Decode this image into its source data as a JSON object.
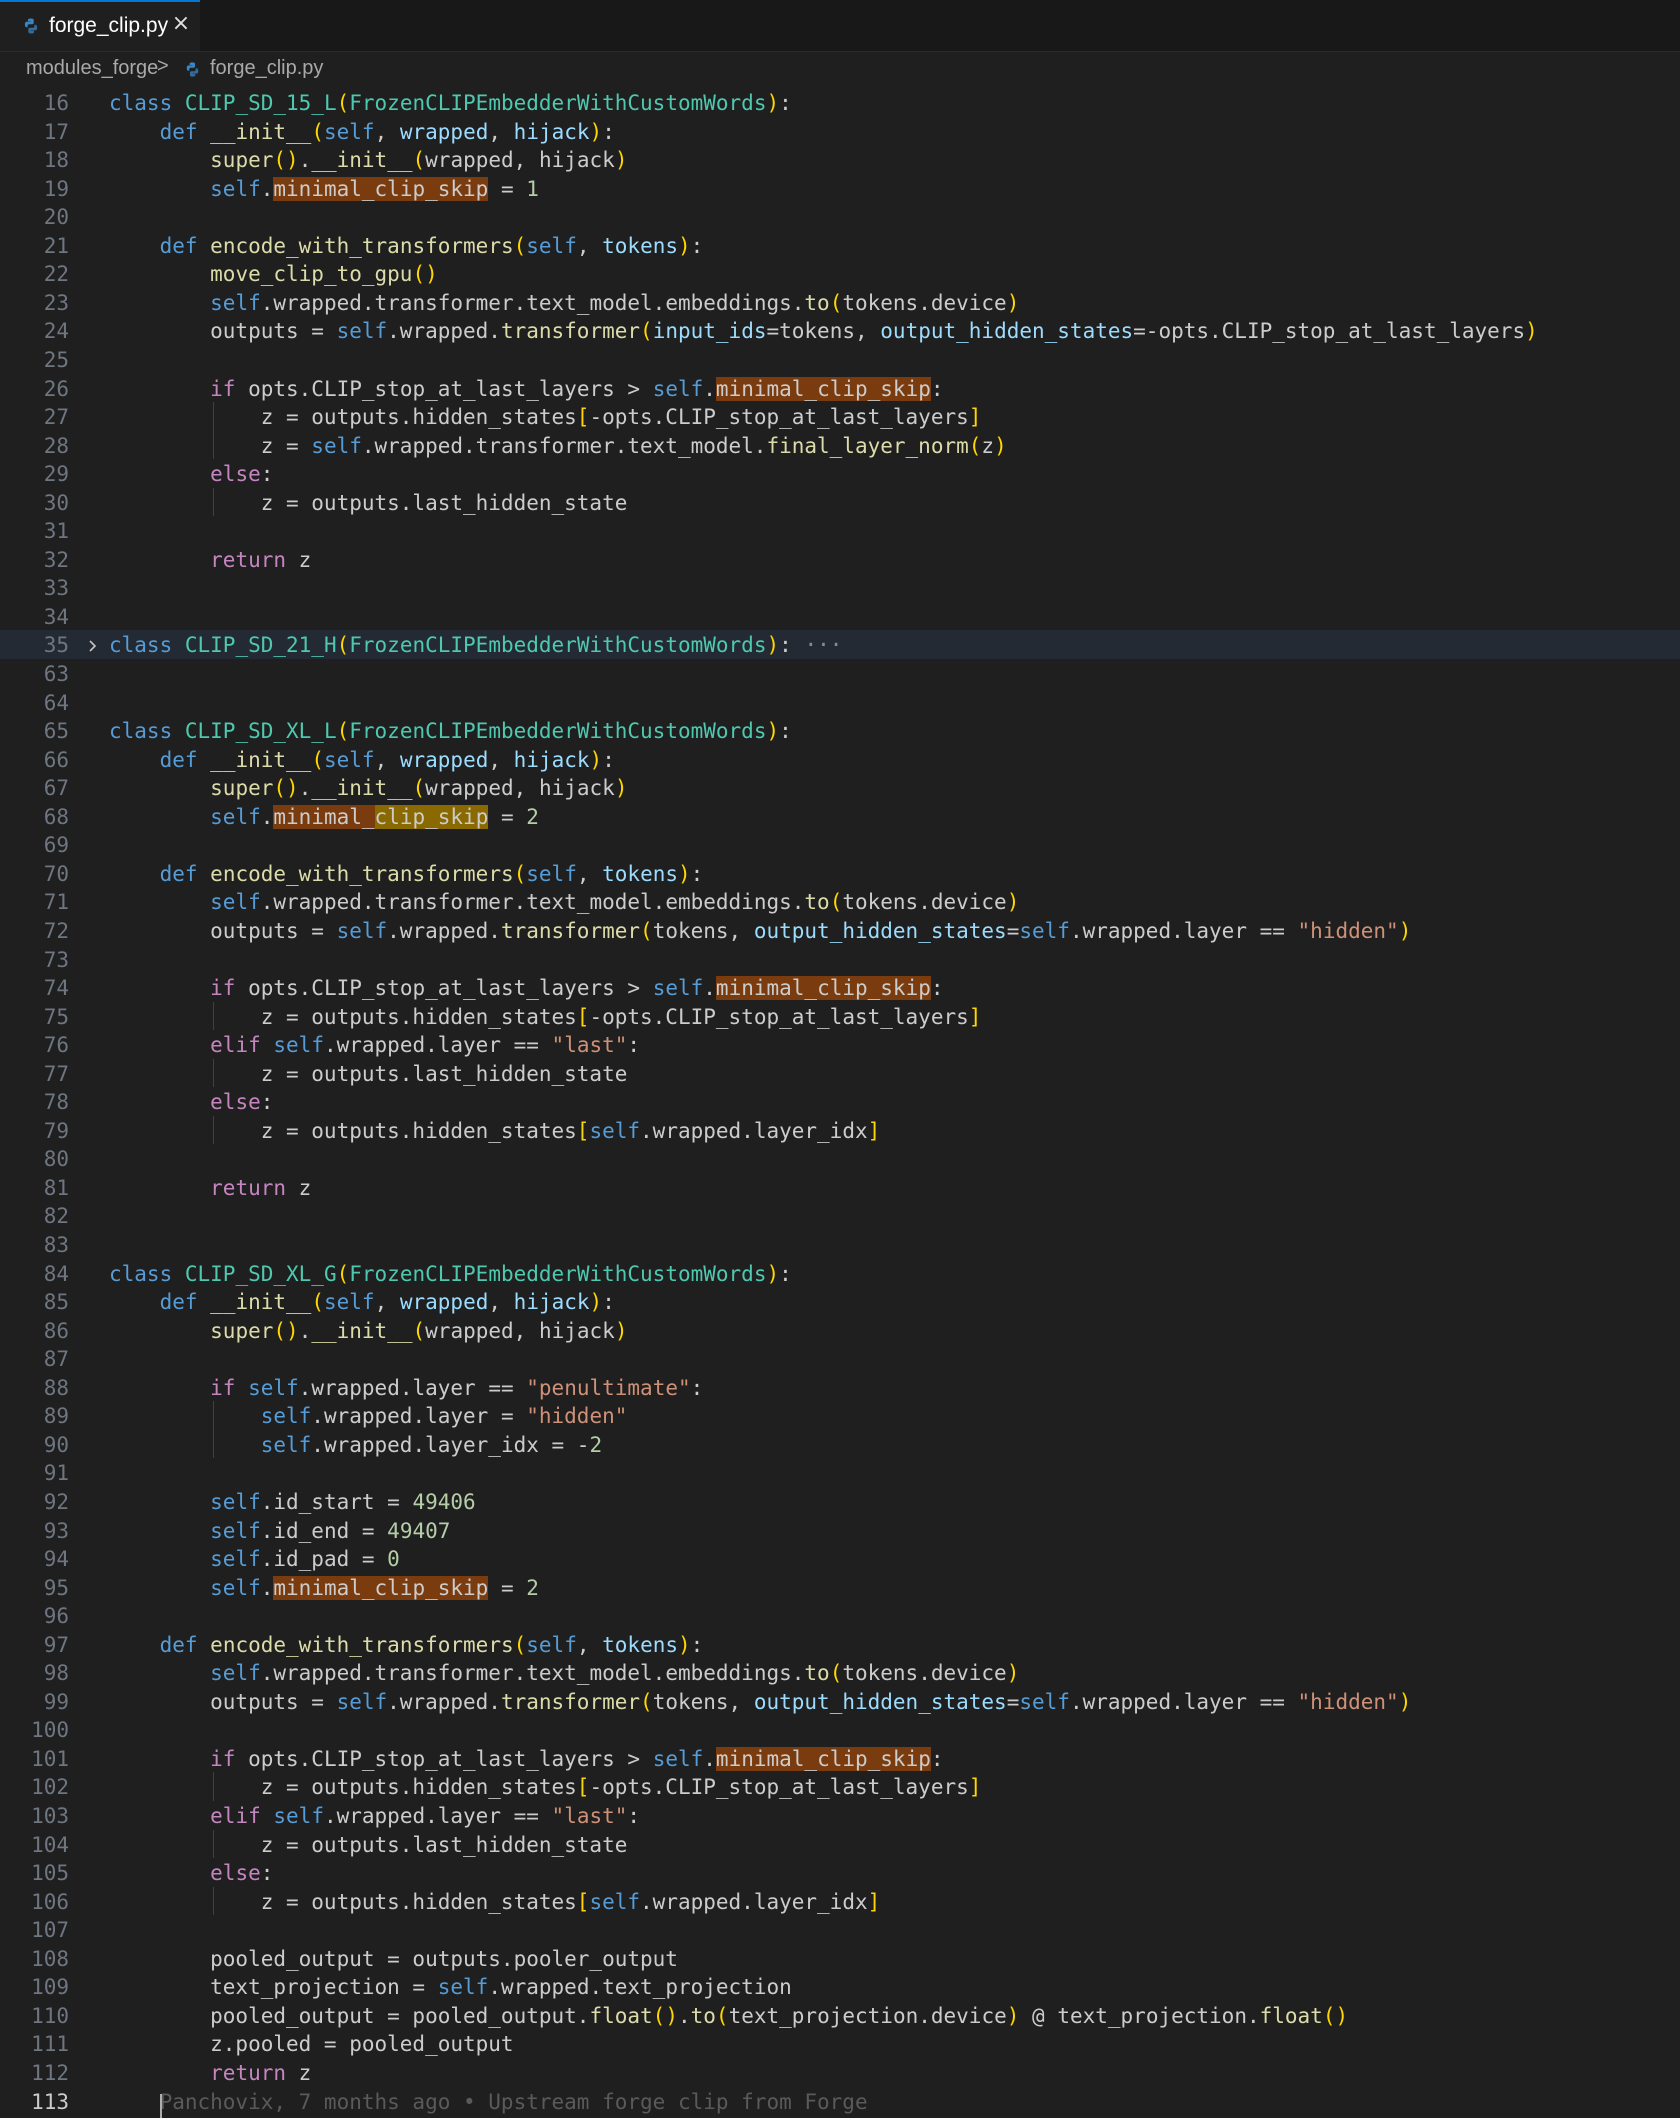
{
  "tab": {
    "label": "forge_clip.py",
    "icon": "python-file-icon",
    "close_icon": "close-icon",
    "close_glyph": "×"
  },
  "breadcrumb": {
    "folder": "modules_forge",
    "separator": ">",
    "file": "forge_clip.py"
  },
  "editor": {
    "accent": "#0078d4",
    "fold_line": "35",
    "blame": "Panchovix, 7 months ago • Upstream forge clip from Forge",
    "lines": [
      {
        "n": "16",
        "t": "class CLIP_SD_15_L(FrozenCLIPEmbedderWithCustomWords):"
      },
      {
        "n": "17",
        "t": "    def __init__(self, wrapped, hijack):"
      },
      {
        "n": "18",
        "t": "        super().__init__(wrapped, hijack)"
      },
      {
        "n": "19",
        "t": "        self.minimal_clip_skip = 1"
      },
      {
        "n": "20",
        "t": ""
      },
      {
        "n": "21",
        "t": "    def encode_with_transformers(self, tokens):"
      },
      {
        "n": "22",
        "t": "        move_clip_to_gpu()"
      },
      {
        "n": "23",
        "t": "        self.wrapped.transformer.text_model.embeddings.to(tokens.device)"
      },
      {
        "n": "24",
        "t": "        outputs = self.wrapped.transformer(input_ids=tokens, output_hidden_states=-opts.CLIP_stop_at_last_layers)"
      },
      {
        "n": "25",
        "t": ""
      },
      {
        "n": "26",
        "t": "        if opts.CLIP_stop_at_last_layers > self.minimal_clip_skip:"
      },
      {
        "n": "27",
        "t": "            z = outputs.hidden_states[-opts.CLIP_stop_at_last_layers]"
      },
      {
        "n": "28",
        "t": "            z = self.wrapped.transformer.text_model.final_layer_norm(z)"
      },
      {
        "n": "29",
        "t": "        else:"
      },
      {
        "n": "30",
        "t": "            z = outputs.last_hidden_state"
      },
      {
        "n": "31",
        "t": ""
      },
      {
        "n": "32",
        "t": "        return z"
      },
      {
        "n": "33",
        "t": ""
      },
      {
        "n": "34",
        "t": ""
      },
      {
        "n": "35",
        "t": "class CLIP_SD_21_H(FrozenCLIPEmbedderWithCustomWords):"
      },
      {
        "n": "63",
        "t": ""
      },
      {
        "n": "64",
        "t": ""
      },
      {
        "n": "65",
        "t": "class CLIP_SD_XL_L(FrozenCLIPEmbedderWithCustomWords):"
      },
      {
        "n": "66",
        "t": "    def __init__(self, wrapped, hijack):"
      },
      {
        "n": "67",
        "t": "        super().__init__(wrapped, hijack)"
      },
      {
        "n": "68",
        "t": "        self.minimal_clip_skip = 2"
      },
      {
        "n": "69",
        "t": ""
      },
      {
        "n": "70",
        "t": "    def encode_with_transformers(self, tokens):"
      },
      {
        "n": "71",
        "t": "        self.wrapped.transformer.text_model.embeddings.to(tokens.device)"
      },
      {
        "n": "72",
        "t": "        outputs = self.wrapped.transformer(tokens, output_hidden_states=self.wrapped.layer == \"hidden\")"
      },
      {
        "n": "73",
        "t": ""
      },
      {
        "n": "74",
        "t": "        if opts.CLIP_stop_at_last_layers > self.minimal_clip_skip:"
      },
      {
        "n": "75",
        "t": "            z = outputs.hidden_states[-opts.CLIP_stop_at_last_layers]"
      },
      {
        "n": "76",
        "t": "        elif self.wrapped.layer == \"last\":"
      },
      {
        "n": "77",
        "t": "            z = outputs.last_hidden_state"
      },
      {
        "n": "78",
        "t": "        else:"
      },
      {
        "n": "79",
        "t": "            z = outputs.hidden_states[self.wrapped.layer_idx]"
      },
      {
        "n": "80",
        "t": ""
      },
      {
        "n": "81",
        "t": "        return z"
      },
      {
        "n": "82",
        "t": ""
      },
      {
        "n": "83",
        "t": ""
      },
      {
        "n": "84",
        "t": "class CLIP_SD_XL_G(FrozenCLIPEmbedderWithCustomWords):"
      },
      {
        "n": "85",
        "t": "    def __init__(self, wrapped, hijack):"
      },
      {
        "n": "86",
        "t": "        super().__init__(wrapped, hijack)"
      },
      {
        "n": "87",
        "t": ""
      },
      {
        "n": "88",
        "t": "        if self.wrapped.layer == \"penultimate\":"
      },
      {
        "n": "89",
        "t": "            self.wrapped.layer = \"hidden\""
      },
      {
        "n": "90",
        "t": "            self.wrapped.layer_idx = -2"
      },
      {
        "n": "91",
        "t": ""
      },
      {
        "n": "92",
        "t": "        self.id_start = 49406"
      },
      {
        "n": "93",
        "t": "        self.id_end = 49407"
      },
      {
        "n": "94",
        "t": "        self.id_pad = 0"
      },
      {
        "n": "95",
        "t": "        self.minimal_clip_skip = 2"
      },
      {
        "n": "96",
        "t": ""
      },
      {
        "n": "97",
        "t": "    def encode_with_transformers(self, tokens):"
      },
      {
        "n": "98",
        "t": "        self.wrapped.transformer.text_model.embeddings.to(tokens.device)"
      },
      {
        "n": "99",
        "t": "        outputs = self.wrapped.transformer(tokens, output_hidden_states=self.wrapped.layer == \"hidden\")"
      },
      {
        "n": "100",
        "t": ""
      },
      {
        "n": "101",
        "t": "        if opts.CLIP_stop_at_last_layers > self.minimal_clip_skip:"
      },
      {
        "n": "102",
        "t": "            z = outputs.hidden_states[-opts.CLIP_stop_at_last_layers]"
      },
      {
        "n": "103",
        "t": "        elif self.wrapped.layer == \"last\":"
      },
      {
        "n": "104",
        "t": "            z = outputs.last_hidden_state"
      },
      {
        "n": "105",
        "t": "        else:"
      },
      {
        "n": "106",
        "t": "            z = outputs.hidden_states[self.wrapped.layer_idx]"
      },
      {
        "n": "107",
        "t": ""
      },
      {
        "n": "108",
        "t": "        pooled_output = outputs.pooler_output"
      },
      {
        "n": "109",
        "t": "        text_projection = self.wrapped.text_projection"
      },
      {
        "n": "110",
        "t": "        pooled_output = pooled_output.float().to(text_projection.device) @ text_projection.float()"
      },
      {
        "n": "111",
        "t": "        z.pooled = pooled_output"
      },
      {
        "n": "112",
        "t": "        return z"
      },
      {
        "n": "113",
        "t": ""
      }
    ]
  }
}
